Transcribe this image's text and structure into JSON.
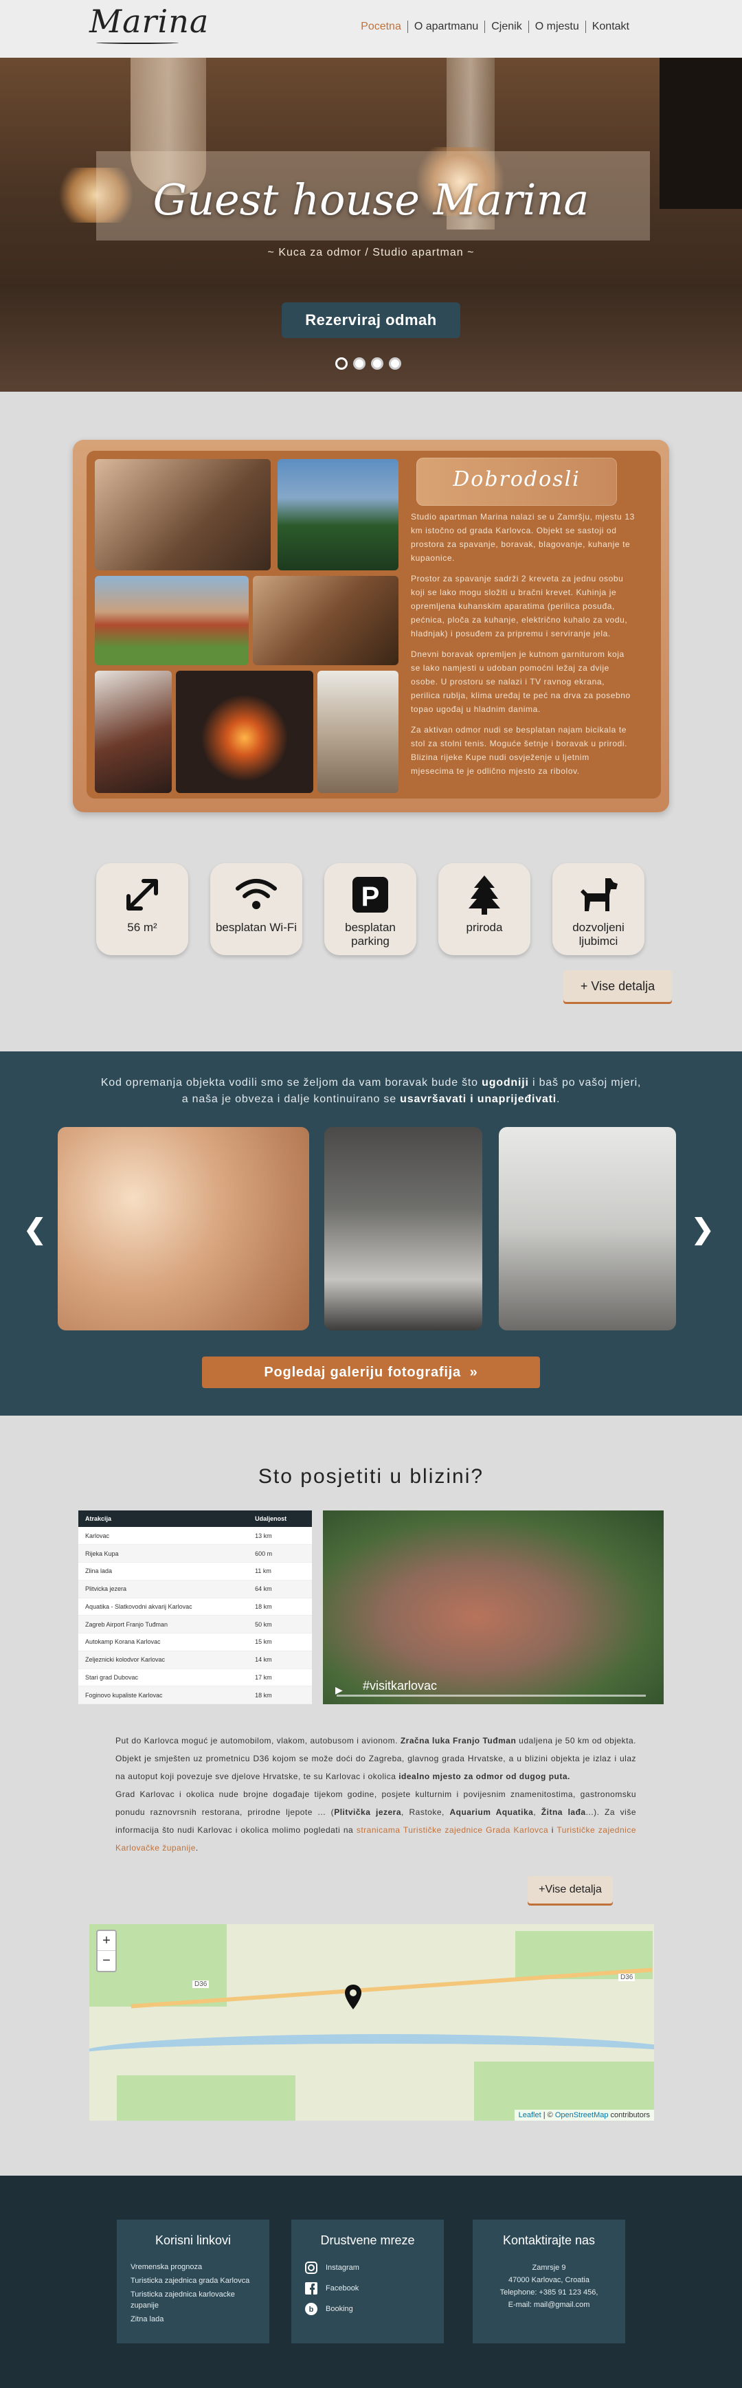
{
  "header": {
    "logo": "Marina",
    "nav": [
      "Pocetna",
      "O apartmanu",
      "Cjenik",
      "O mjestu",
      "Kontakt"
    ]
  },
  "hero": {
    "title": "Guest house Marina",
    "subtitle": "~ Kuca za odmor / Studio apartman ~",
    "cta": "Rezerviraj odmah"
  },
  "welcome": {
    "title": "Dobrodosli",
    "paragraphs": [
      "Studio apartman Marina nalazi se u Zamršju, mjestu 13 km istočno od grada Karlovca. Objekt se sastoji od prostora za spavanje, boravak, blagovanje, kuhanje te kupaonice.",
      "Prostor za spavanje sadrži 2 kreveta za jednu osobu koji se lako mogu složiti u bračni krevet. Kuhinja je opremljena kuhanskim aparatima (perilica posuđa, pećnica, ploča za kuhanje, električno kuhalo za vodu, hladnjak) i posuđem za pripremu i serviranje jela.",
      "Dnevni boravak opremljen je kutnom garniturom koja se lako namjesti u udoban pomoćni ležaj za dvije osobe. U prostoru se nalazi i TV ravnog ekrana, perilica rublja, klima uređaj te peć na drva za posebno topao ugođaj u hladnim danima.",
      "Za aktivan odmor nudi se besplatan najam bicikala te stol za stolni tenis. Moguće šetnje i boravak u prirodi. Blizina rijeke Kupe nudi osvježenje u ljetnim mjesecima te je odlično mjesto za ribolov."
    ]
  },
  "amenities": [
    {
      "icon": "arrows-expand-icon",
      "label": "56 m²"
    },
    {
      "icon": "wifi-icon",
      "label": "besplatan Wi-Fi"
    },
    {
      "icon": "parking-icon",
      "label": "besplatan parking"
    },
    {
      "icon": "tree-icon",
      "label": "priroda"
    },
    {
      "icon": "dog-icon",
      "label": "dozvoljeni ljubimci"
    }
  ],
  "more_details": "Vise detalja",
  "gallery": {
    "line1_pre": "Kod opremanja objekta vodili smo se željom da vam boravak bude što ",
    "line1_bold": "ugodniji",
    "line1_post": " i baš po vašoj mjeri,",
    "line2_pre": "a naša je obveza i dalje kontinuirano se ",
    "line2_bold": "usavršavati i unaprijeđivati",
    "line2_post": ".",
    "button": "Pogledaj galeriju fotografija"
  },
  "nearby": {
    "title": "Sto posjetiti u blizini?",
    "table_headers": [
      "Atrakcija",
      "Udaljenost"
    ],
    "table_rows": [
      [
        "Karlovac",
        "13 km"
      ],
      [
        "Rijeka Kupa",
        "600 m"
      ],
      [
        "Zlina lada",
        "11 km"
      ],
      [
        "Plitvicka jezera",
        "64 km"
      ],
      [
        "Aquatika - Slatkovodni akvarij Karlovac",
        "18 km"
      ],
      [
        "Zagreb Airport Franjo Tuđman",
        "50 km"
      ],
      [
        "Autokamp Korana Karlovac",
        "15 km"
      ],
      [
        "Zeljeznicki kolodvor Karlovac",
        "14 km"
      ],
      [
        "Stari grad Dubovac",
        "17 km"
      ],
      [
        "Foginovo kupaliste Karlovac",
        "18 km"
      ]
    ],
    "video_label": "#visitkarlovac",
    "text_1": "Put do Karlovca moguć je automobilom, vlakom, autobusom i avionom.",
    "text_1_bold": "Zračna luka Franjo Tuđman",
    "text_2": "udaljena je 50 km od objekta. Objekt je smješten uz prometnicu D36 kojom se može doći do Zagreba, glavnog grada Hrvatske, a u blizini objekta je izlaz i ulaz na autoput koji povezuje sve djelove Hrvatske, te su Karlovac i okolica",
    "text_2_bold": "idealno mjesto za odmor od dugog puta.",
    "text_3": "Grad Karlovac i okolica nude brojne događaje tijekom godine, posjete kulturnim i povijesnim znamenitostima, gastronomsku ponudu raznovrsnih restorana, prirodne ljepote ...",
    "text_3_bold1": "Plitvička jezera",
    "text_3_mid": ", Rastoke,",
    "text_3_bold2": "Aquarium Aquatika",
    "text_3_sep": ",",
    "text_3_bold3": "Žitna lađa",
    "text_3_end": "...). Za više informacija što nudi Karlovac i okolica molimo pogledati na",
    "link_1": "stranicama Turističke zajednice",
    "link_2": "Grada Karlovca",
    "link_sep": " i ",
    "link_3": "Turističke zajednice Karlovačke županije",
    "more": "Vise detalja"
  },
  "map": {
    "attribution_pre": "Leaflet",
    "attribution_mid": " | © ",
    "attribution_link": "OpenStreetMap",
    "attribution_post": " contributors",
    "road": "D36"
  },
  "footer": {
    "links_title": "Korisni linkovi",
    "links": [
      "Vremenska prognoza",
      "Turisticka zajednica grada Karlovca",
      "Turisticka zajednica karlovacke zupanije",
      "Zitna lada"
    ],
    "social_title": "Drustvene mreze",
    "social": [
      "Instagram",
      "Facebook",
      "Booking"
    ],
    "contact_title": "Kontaktirajte nas",
    "contact": [
      "Zamrsje 9",
      "47000 Karlovac, Croatia",
      "Telephone: +385 91 123 456,",
      "E-mail: mail@gmail.com"
    ]
  },
  "colors": {
    "accent": "#c0713a",
    "teal": "#2d4a56",
    "footer": "#1f2f38"
  }
}
